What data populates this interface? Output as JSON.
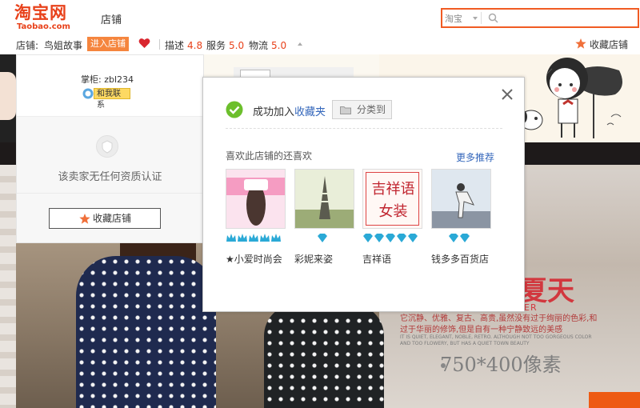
{
  "header": {
    "logo_main": "淘宝网",
    "logo_sub": "Taobao.com",
    "section": "店铺",
    "search_scope": "淘宝"
  },
  "shopbar": {
    "shop_label": "店铺:",
    "shop_name": "鸟姐故事",
    "enter_shop": "进入店铺",
    "ratings": [
      {
        "label": "描述",
        "value": "4.8"
      },
      {
        "label": "服务",
        "value": "5.0"
      },
      {
        "label": "物流",
        "value": "5.0"
      }
    ],
    "favorite_shop": "收藏店铺"
  },
  "info_panel": {
    "keeper": "掌柜: zbl234",
    "contact": "和我联系",
    "cert_text": "该卖家无任何资质认证",
    "collect_button": "收藏店铺"
  },
  "modal": {
    "success_prefix": "成功加入",
    "success_link": "收藏夹",
    "classify_button": "分类到",
    "rec_title": "喜欢此店铺的还喜欢",
    "more_link": "更多推荐",
    "items": [
      {
        "name": "★小爱时尚会",
        "rank_icon": "crown-icon",
        "rank_count": 5
      },
      {
        "name": "彩妮来姿",
        "rank_icon": "diamond-icon",
        "rank_count": 1
      },
      {
        "name": "吉祥语",
        "rank_icon": "diamond-icon",
        "rank_count": 5,
        "thumb_text_1": "吉祥语",
        "thumb_text_2": "女装"
      },
      {
        "name": "钱多多百货店",
        "rank_icon": "diamond-icon",
        "rank_count": 2
      }
    ]
  },
  "banner": {
    "title": "夏天",
    "subtitle_fragment": "ER",
    "text_cn": "它沉静、优雅、复古、高贵,虽然没有过于绚丽的色彩,和过于华丽的修饰,但是自有一种宁静致远的美感",
    "text_en": "IT IS QUIET, ELEGANT, NOBLE, RETRO. ALTHOUGH NOT TOO GORGEOUS COLOR AND TOO FLOWERY, BUT HAS A QUIET TOWN BEAUTY",
    "size_note": "750*400像素"
  },
  "colors": {
    "brand": "#e8411a",
    "search_border": "#f05b23",
    "link": "#3366bb",
    "success": "#6cbf2c",
    "diamond": "#2aa9d6"
  }
}
